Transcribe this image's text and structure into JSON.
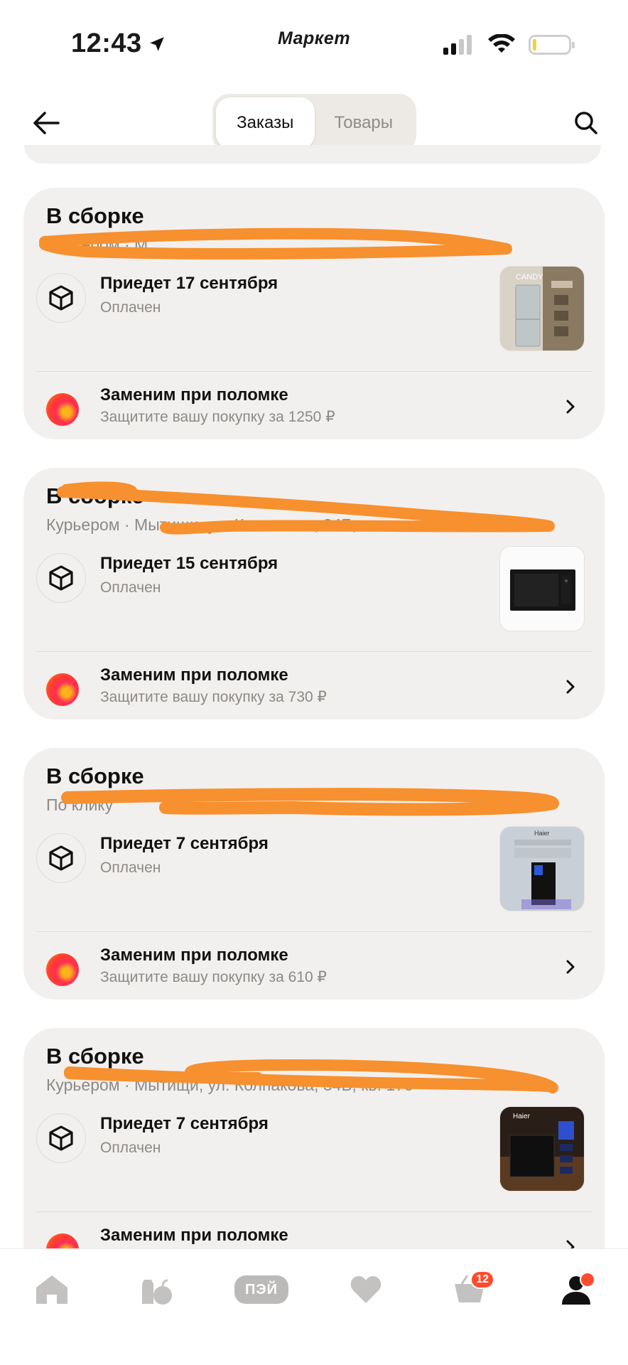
{
  "status_bar": {
    "time": "12:43",
    "app_brand": "Маркет",
    "icons": [
      "location-arrow-icon",
      "signal-icon",
      "wifi-icon",
      "battery-icon"
    ]
  },
  "header": {
    "tabs": [
      {
        "label": "Заказы",
        "active": true
      },
      {
        "label": "Товары",
        "active": false
      }
    ],
    "icons": [
      "back-arrow-icon",
      "search-icon"
    ]
  },
  "orders": [
    {
      "status": "В сборке",
      "address": "Курьером · М",
      "arrival": "Приедет 17 сентября",
      "payment": "Оплачен",
      "product_thumb": "fridge-image",
      "thumb_brand": "CANDY",
      "protection_title": "Заменим при поломке",
      "protection_sub": "Защитите вашу покупку за 1250 ₽"
    },
    {
      "status": "В сборке",
      "address": "Курьером · Мытищи, ул. Колпакова, 34Б, кв.",
      "arrival": "Приедет 15 сентября",
      "payment": "Оплачен",
      "product_thumb": "microwave-image",
      "thumb_brand": "",
      "protection_title": "Заменим при поломке",
      "protection_sub": "Защитите вашу покупку за 730 ₽"
    },
    {
      "status": "В сборке",
      "address": "По клику",
      "arrival": "Приедет 7 сентября",
      "payment": "Оплачен",
      "product_thumb": "induction-hob-image",
      "thumb_brand": "Haier",
      "protection_title": "Заменим при поломке",
      "protection_sub": "Защитите вашу покупку за 610 ₽"
    },
    {
      "status": "В сборке",
      "address": "Курьером · Мытищи, ул. Колпакова, 34Б, кв. 170",
      "arrival": "Приедет 7 сентября",
      "payment": "Оплачен",
      "product_thumb": "oven-image",
      "thumb_brand": "Haier",
      "protection_title": "Заменим при поломке",
      "protection_sub": ""
    }
  ],
  "tab_bar": {
    "items": [
      {
        "icon": "home-icon"
      },
      {
        "icon": "grocery-icon"
      },
      {
        "icon": "pay-icon",
        "label": "ПЭЙ"
      },
      {
        "icon": "heart-icon"
      },
      {
        "icon": "cart-icon",
        "badge": "12"
      },
      {
        "icon": "profile-icon",
        "dot": true
      }
    ]
  },
  "colors": {
    "card_bg": "#f2f0ee",
    "muted_text": "#8d8985",
    "redaction_orange": "#f7902e",
    "badge_red": "#ff4a2e"
  }
}
